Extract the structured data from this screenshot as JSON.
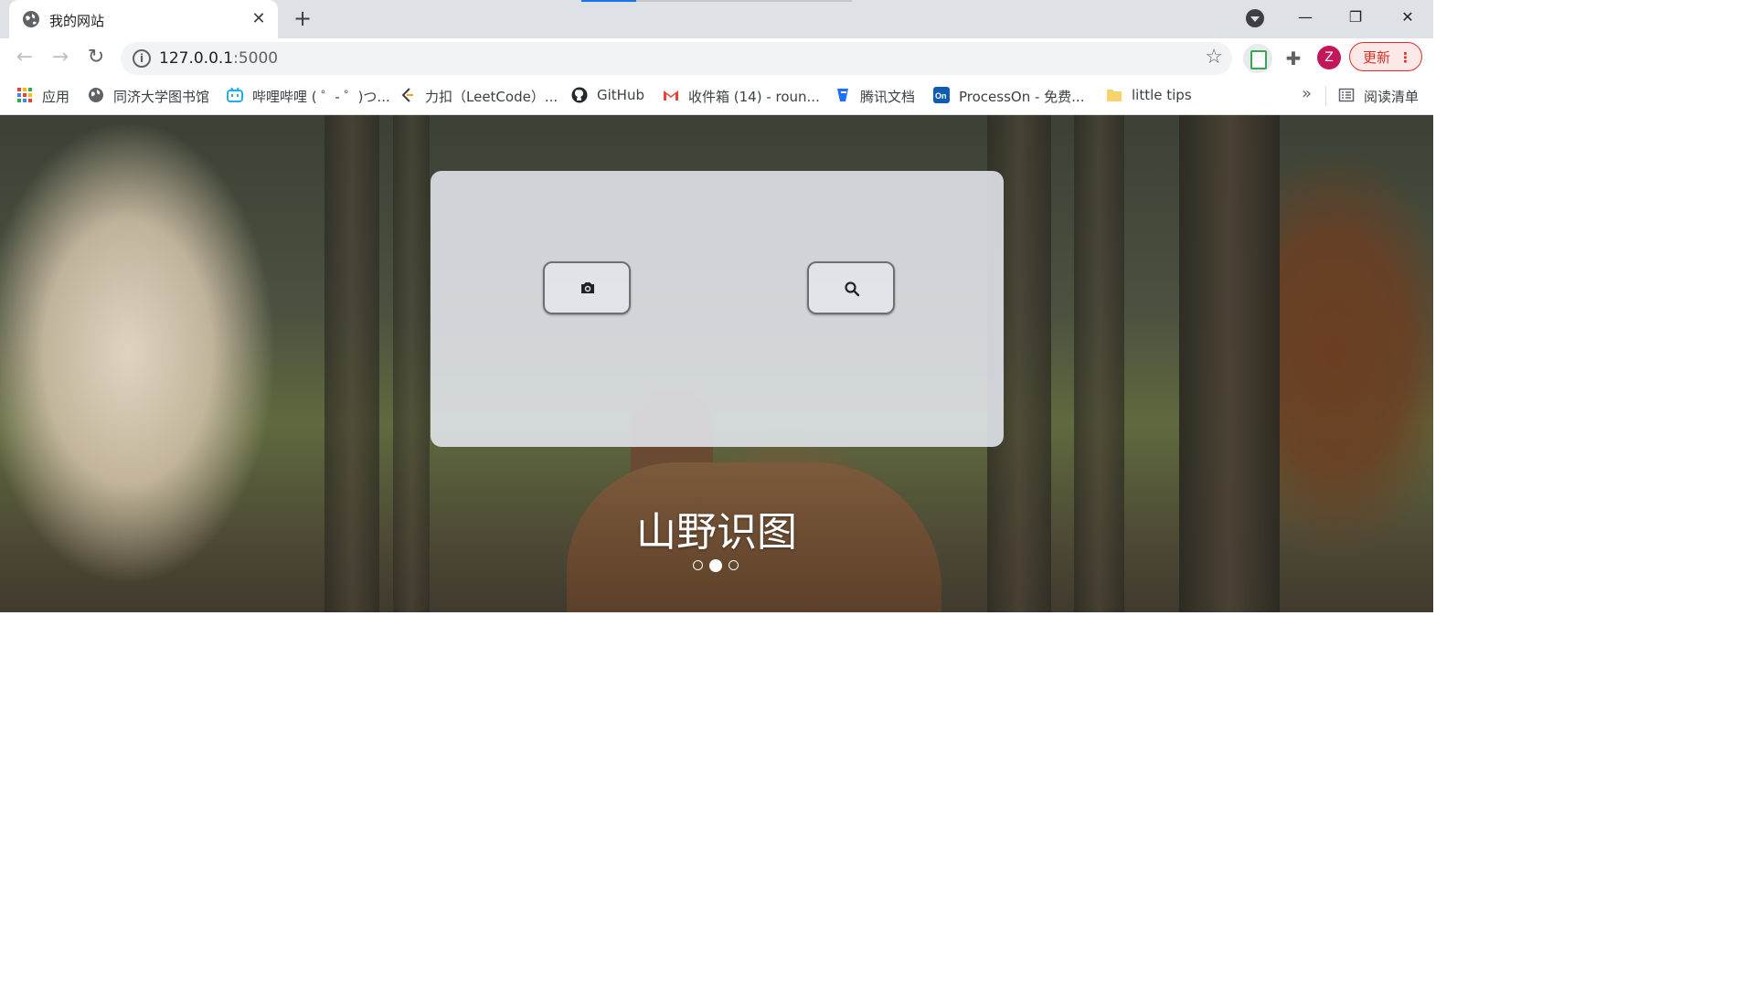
{
  "browser": {
    "tab": {
      "title": "我的网站",
      "close_label": "✕"
    },
    "new_tab_label": "+",
    "window_controls": {
      "minimize": "—",
      "restore": "❐",
      "close": "✕"
    },
    "address": {
      "host": "127.0.0.1",
      "port": ":5000"
    },
    "avatar_letter": "Z",
    "update_label": "更新",
    "menu_dots": "⋮"
  },
  "bookmarks": [
    {
      "label": "应用",
      "icon": "apps-grid-icon",
      "color": "#ea4335"
    },
    {
      "label": "同济大学图书馆",
      "icon": "globe-icon",
      "color": "#5f6368"
    },
    {
      "label": "哔哩哔哩 ( ゜- ゜)つ...",
      "icon": "bilibili-icon",
      "color": "#23ade5"
    },
    {
      "label": "力扣（LeetCode）...",
      "icon": "leetcode-icon",
      "color": "#ffa116"
    },
    {
      "label": "GitHub",
      "icon": "github-icon",
      "color": "#24292e"
    },
    {
      "label": "收件箱 (14) - roun...",
      "icon": "gmail-icon",
      "color": "#ea4335"
    },
    {
      "label": "腾讯文档",
      "icon": "tencent-docs-icon",
      "color": "#1e6fff"
    },
    {
      "label": "ProcessOn - 免费...",
      "icon": "processon-icon",
      "color": "#0e5db3"
    },
    {
      "label": "little tips",
      "icon": "folder-icon",
      "color": "#f6d36b"
    }
  ],
  "bookmarks_more": "»",
  "reading_list": "阅读清单",
  "hero": {
    "title": "山野识图",
    "camera_button": "camera-icon",
    "search_button": "search-icon",
    "carousel_active_index": 1,
    "carousel_count": 3
  }
}
